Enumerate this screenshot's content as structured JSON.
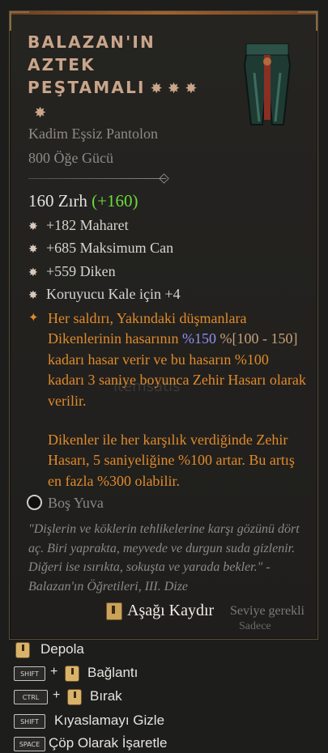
{
  "item": {
    "title_lines": [
      "BALAZAN'IN",
      "AZTEK",
      "PEŞTAMALI"
    ],
    "title_stars": "✸ ✸ ✸",
    "title_star_last": "✸",
    "type": "Kadim Eşsiz Pantolon",
    "item_power": "800 Öğe Gücü",
    "armor": "160 Zırh",
    "armor_bonus": "(+160)",
    "affixes": [
      {
        "icon": "star-bullet-icon",
        "text": "+182 Maharet"
      },
      {
        "icon": "star-bullet-icon",
        "text": "+685 Maksimum Can"
      },
      {
        "icon": "star-bullet-icon",
        "text": "+559 Diken"
      },
      {
        "icon": "star-bullet-icon",
        "text": "Koruyucu Kale için +4"
      }
    ],
    "legendary": {
      "p1_a": "Her saldırı, Yakındaki düşmanlara Dikenlerinin hasarının ",
      "p1_num": "%150",
      "p1_range": " %[100 - 150]",
      "p1_b": " kadarı hasar verir ve bu hasarın %100 kadarı 3 saniye boyunca Zehir Hasarı olarak verilir.",
      "p2": "Dikenler ile her karşılık verdiğinde Zehir Hasarı, 5 saniyeliğine %100 artar. Bu artış en fazla %300 olabilir."
    },
    "socket_label": "Boş Yuva",
    "flavor": "\"Dişlerin ve köklerin tehlikelerine karşı gözünü dört aç. Biri yaprakta, meyvede ve durgun suda gizlenir. Diğeri ise ısırıkta, sokuşta ve yarada bekler.\" -Balazan'ın Öğretileri, III. Dize",
    "scroll_hint": "Aşağı Kaydır",
    "level_req": "Seviye gerekli",
    "only_text": "Sadece",
    "watermark": "itemsatis"
  },
  "footer": {
    "actions": [
      {
        "keys": [],
        "mouse": true,
        "label": "Depola"
      },
      {
        "keys": [
          "SHIFT"
        ],
        "mouse": true,
        "label": "Bağlantı"
      },
      {
        "keys": [
          "CTRL"
        ],
        "mouse": true,
        "label": "Bırak"
      },
      {
        "keys": [
          "SHIFT"
        ],
        "mouse": false,
        "label": "Kıyaslamayı Gizle"
      },
      {
        "keys": [
          "SPACE"
        ],
        "mouse": false,
        "label": "Çöp Olarak İşaretle"
      }
    ],
    "plus": "+"
  },
  "colors": {
    "title": "#c9a58a",
    "legendary": "#e08a2a",
    "armor_bonus": "#6ddc3c",
    "highlight_number": "#8f8ff5"
  }
}
